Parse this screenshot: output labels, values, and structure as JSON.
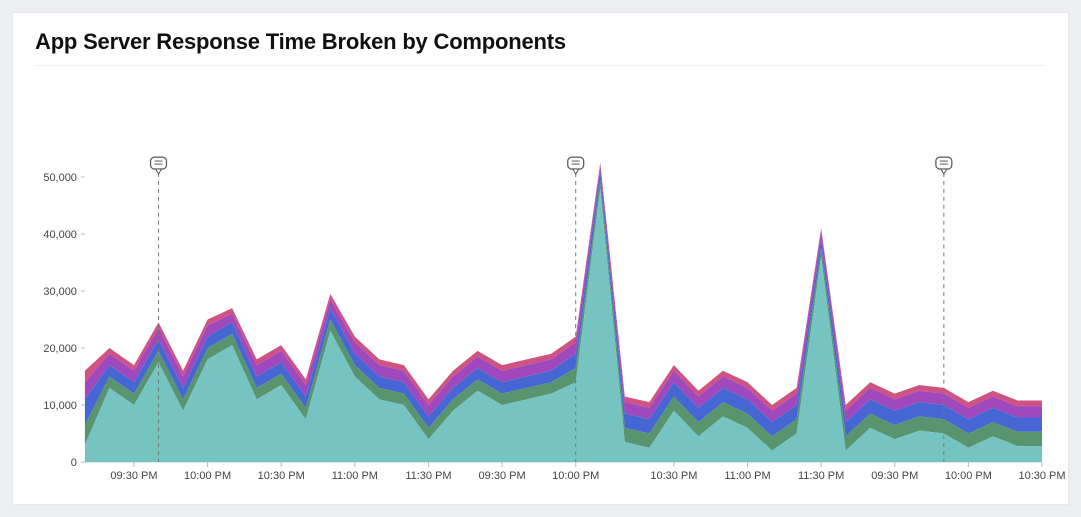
{
  "title": "App Server Response Time Broken by Components",
  "chart_data": {
    "type": "area",
    "stacked": true,
    "title": "App Server Response Time Broken by Components",
    "xlabel": "",
    "ylabel": "",
    "ylim": [
      0,
      50000
    ],
    "y_ticks": [
      0,
      10000,
      20000,
      30000,
      40000,
      50000
    ],
    "y_tick_labels": [
      "0",
      "10,000",
      "20,000",
      "30,000",
      "40,000",
      "50,000"
    ],
    "x_tick_labels": [
      "09:30 PM",
      "10:00 PM",
      "10:30 PM",
      "11:00 PM",
      "11:30 PM",
      "09:30 PM",
      "10:00 PM",
      "10:30 PM",
      "11:00 PM",
      "11:30 PM",
      "09:30 PM",
      "10:00 PM",
      "10:30 PM"
    ],
    "x_tick_positions": [
      2,
      5,
      8,
      11,
      14,
      17,
      20,
      24,
      27,
      30,
      33,
      36,
      39
    ],
    "annotations": [
      {
        "type": "comment-marker",
        "x_index": 3
      },
      {
        "type": "comment-marker",
        "x_index": 20
      },
      {
        "type": "comment-marker",
        "x_index": 35
      }
    ],
    "colors": {
      "teal": "#6ec1bf",
      "green": "#4f8f67",
      "blue": "#3c5fd1",
      "purple": "#9a3fb9",
      "magenta": "#cc4a7b"
    },
    "series": [
      {
        "name": "teal",
        "color": "#6ec1bf",
        "values": [
          3000,
          13000,
          10000,
          17500,
          9000,
          18000,
          20500,
          11000,
          13500,
          7500,
          23000,
          15000,
          11000,
          10000,
          4000,
          9000,
          12500,
          10000,
          11000,
          12000,
          14000,
          48000,
          3500,
          2500,
          9000,
          4500,
          8000,
          6000,
          2000,
          5000,
          36000,
          2000,
          6000,
          4000,
          5500,
          5000,
          2500,
          4500,
          2800,
          2800
        ]
      },
      {
        "name": "green",
        "color": "#4f8f67",
        "values": [
          3500,
          2000,
          2000,
          2000,
          2000,
          2000,
          2000,
          2000,
          2000,
          2000,
          2000,
          2000,
          2000,
          2000,
          2000,
          2000,
          2000,
          2000,
          2000,
          2000,
          2500,
          1500,
          2500,
          2500,
          2500,
          2500,
          2500,
          2500,
          2500,
          2500,
          1500,
          2500,
          2500,
          2500,
          2500,
          2500,
          2500,
          2500,
          2500,
          2500
        ]
      },
      {
        "name": "blue",
        "color": "#3c5fd1",
        "values": [
          4500,
          2000,
          2000,
          2000,
          2000,
          2000,
          2000,
          2000,
          2000,
          2000,
          2000,
          2000,
          2000,
          2000,
          2000,
          2000,
          2000,
          2000,
          2000,
          2000,
          2500,
          1500,
          2500,
          2500,
          2500,
          2500,
          2500,
          2500,
          2500,
          2500,
          1500,
          2500,
          2500,
          2500,
          2500,
          2500,
          2500,
          2500,
          2500,
          2500
        ]
      },
      {
        "name": "purple",
        "color": "#9a3fb9",
        "values": [
          3000,
          2000,
          2000,
          2000,
          2000,
          2000,
          1500,
          2000,
          2000,
          2000,
          1500,
          2000,
          2000,
          2000,
          2000,
          2000,
          2000,
          2000,
          2000,
          2000,
          2000,
          1000,
          2000,
          2000,
          2000,
          2000,
          2000,
          2000,
          2000,
          2000,
          1500,
          2000,
          2000,
          2000,
          2000,
          2000,
          2000,
          2000,
          2000,
          2000
        ]
      },
      {
        "name": "magenta",
        "color": "#cc4a7b",
        "values": [
          2000,
          1000,
          1000,
          1000,
          1000,
          1000,
          1000,
          1000,
          1000,
          1000,
          1000,
          1000,
          1000,
          1000,
          1000,
          1000,
          1000,
          1000,
          1000,
          1000,
          1000,
          500,
          1000,
          1000,
          1000,
          1000,
          1000,
          1000,
          1000,
          1000,
          500,
          1000,
          1000,
          1000,
          1000,
          1000,
          1000,
          1000,
          1000,
          1000
        ]
      }
    ]
  }
}
